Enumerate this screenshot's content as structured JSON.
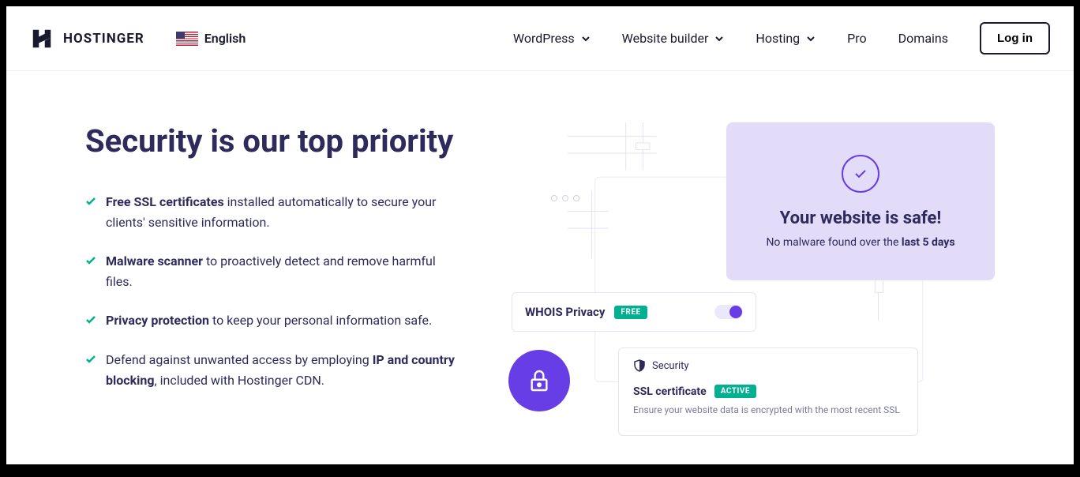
{
  "header": {
    "brand": "HOSTINGER",
    "language": "English",
    "nav": {
      "wordpress": "WordPress",
      "builder": "Website builder",
      "hosting": "Hosting",
      "pro": "Pro",
      "domains": "Domains"
    },
    "login": "Log in"
  },
  "hero": {
    "heading": "Security is our top priority",
    "bullets": [
      {
        "bold1": "Free SSL certificates",
        "rest": " installed automatically to secure your clients' sensitive information."
      },
      {
        "bold1": "Malware scanner",
        "rest": " to proactively detect and remove harmful files."
      },
      {
        "bold1": "Privacy protection",
        "rest": " to keep your personal information safe."
      },
      {
        "pre": "Defend against unwanted access by employing ",
        "bold1": "IP and country blocking",
        "rest": ", included with Hostinger CDN."
      }
    ]
  },
  "illustration": {
    "safe_title": "Your website is safe!",
    "safe_sub_pre": "No malware found over the ",
    "safe_sub_bold": "last 5 days",
    "whois_label": "WHOIS Privacy",
    "whois_badge": "FREE",
    "ssl_section_title": "Security",
    "ssl_title": "SSL certificate",
    "ssl_badge": "ACTIVE",
    "ssl_desc": "Ensure your website data is encrypted with the most recent SSL"
  }
}
